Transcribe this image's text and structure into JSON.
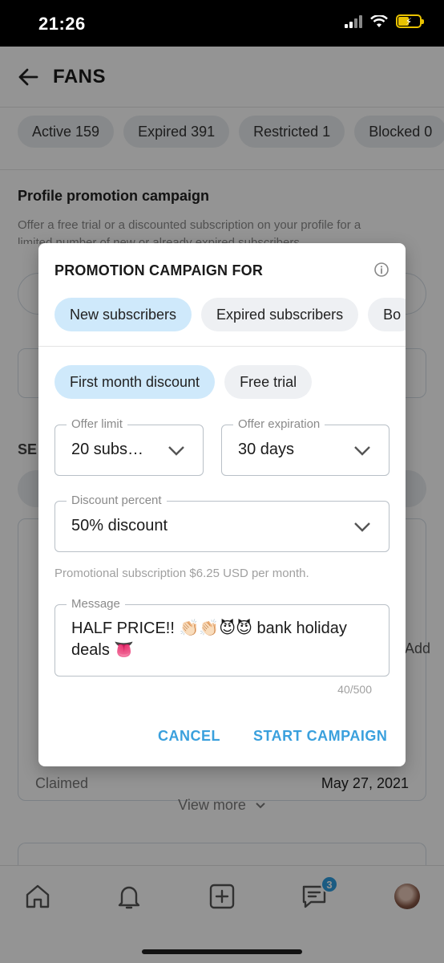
{
  "status_bar": {
    "time": "21:26"
  },
  "header": {
    "title": "FANS"
  },
  "filter_chips": [
    "Active 159",
    "Expired 391",
    "Restricted 1",
    "Blocked 0"
  ],
  "promotion": {
    "title": "Profile promotion campaign",
    "description": "Offer a free trial or a discounted subscription on your profile for a limited number of new or already expired subscribers"
  },
  "background": {
    "section_label_fragment": "SE",
    "add_fragment": "Add",
    "claimed_label": "Claimed",
    "claimed_date": "May 27, 2021",
    "view_more": "View more"
  },
  "dialog": {
    "title": "PROMOTION CAMPAIGN FOR",
    "audience_tabs": [
      "New subscribers",
      "Expired subscribers",
      "Bo"
    ],
    "offer_types": [
      "First month discount",
      "Free trial"
    ],
    "offer_limit": {
      "label": "Offer limit",
      "value": "20 subs…"
    },
    "offer_expiration": {
      "label": "Offer expiration",
      "value": "30 days"
    },
    "discount_percent": {
      "label": "Discount percent",
      "value": "50% discount"
    },
    "helper_text": "Promotional subscription $6.25 USD per month.",
    "message": {
      "label": "Message",
      "value": "HALF PRICE!! 👏🏻👏🏻😈😈 bank holiday deals 👅"
    },
    "char_counter": "40/500",
    "cancel_label": "CANCEL",
    "start_label": "START CAMPAIGN"
  },
  "bottom_nav": {
    "messages_badge": "3"
  },
  "colors": {
    "accent": "#3aa0dd",
    "active_chip": "#cfe9fb",
    "badge": "#2d9ee0"
  }
}
